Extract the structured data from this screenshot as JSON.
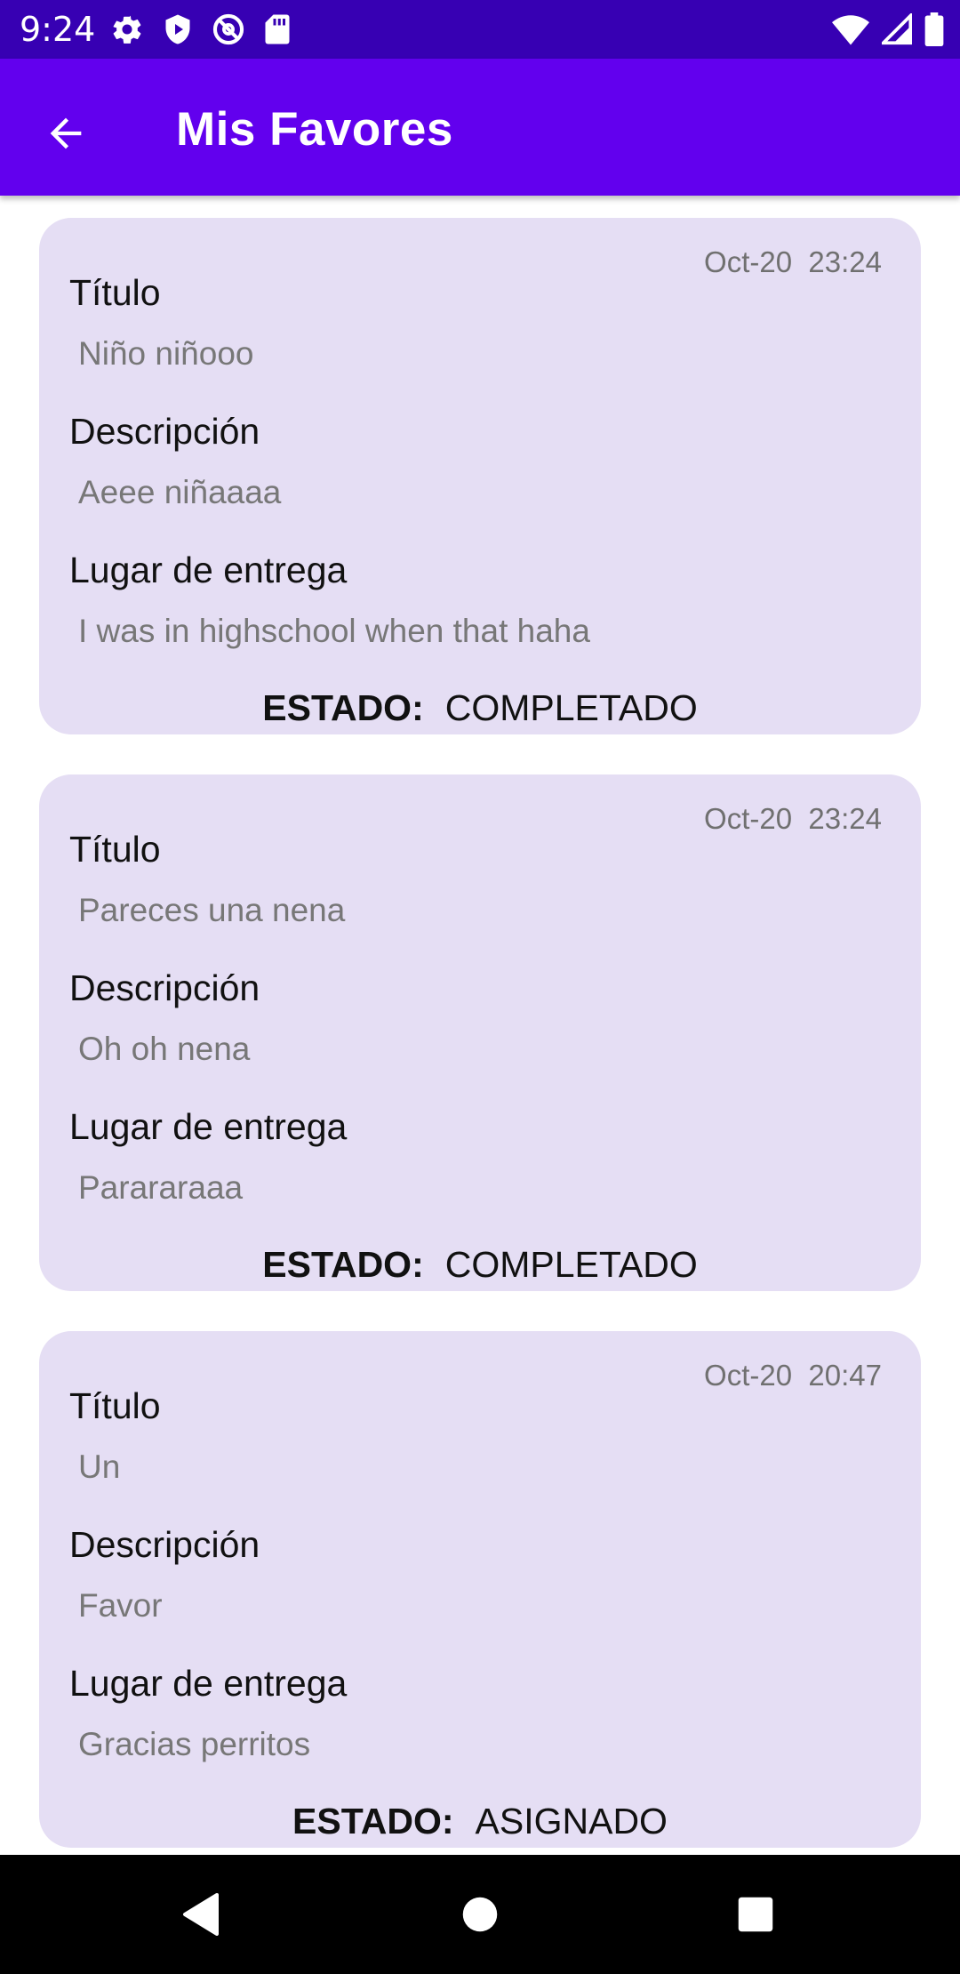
{
  "status_bar": {
    "time": "9:24",
    "left_icons": [
      "gear-icon",
      "shield-play-icon",
      "no-signal-at-icon",
      "sd-card-icon"
    ],
    "right_icons": [
      "wifi-icon",
      "cell-signal-icon",
      "battery-icon"
    ]
  },
  "app_bar": {
    "back_icon": "arrow-back-icon",
    "title": "Mis Favores",
    "background": "#6200ee"
  },
  "labels": {
    "titulo": "Título",
    "descripcion": "Descripción",
    "lugar": "Lugar de entrega",
    "estado": "ESTADO:"
  },
  "favors": [
    {
      "date": "Oct-20  23:24",
      "title": "Niño niñooo",
      "description": "Aeee niñaaaa",
      "place": "I was in highschool when that haha",
      "status": "COMPLETADO"
    },
    {
      "date": "Oct-20  23:24",
      "title": "Pareces una nena",
      "description": "Oh oh nena",
      "place": "Parararaaa",
      "status": "COMPLETADO"
    },
    {
      "date": "Oct-20  20:47",
      "title": "Un",
      "description": "Favor",
      "place": "Gracias perritos",
      "status": "ASIGNADO"
    }
  ],
  "nav_bar": {
    "buttons": [
      "back-triangle-icon",
      "home-circle-icon",
      "recents-square-icon"
    ]
  },
  "colors": {
    "status_bar": "#3700b3",
    "app_bar": "#6200ee",
    "card": "#e5def4"
  }
}
